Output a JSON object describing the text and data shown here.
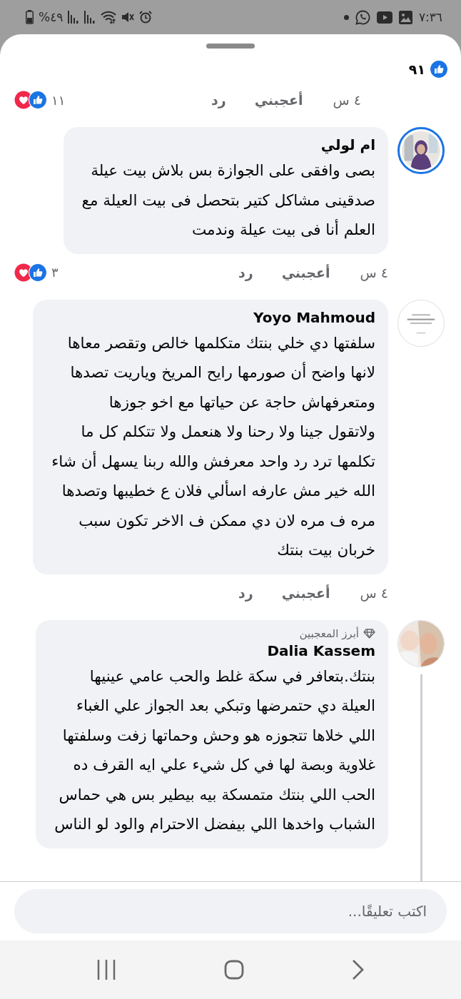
{
  "status_bar": {
    "time": "٧:٣٦",
    "battery": "%٤٩"
  },
  "reaction_summary": {
    "count": "٩١"
  },
  "previous_actions": {
    "time": "٤ س",
    "like": "أعجبني",
    "reply": "رد",
    "reaction_count": "١١"
  },
  "comments": [
    {
      "author": "ام لولي",
      "avatar_ring": true,
      "thread_line": false,
      "lines": [
        "بصى وافقى على الجوازة بس بلاش بيت عيلة",
        "صدقينى مشاكل كتير بتحصل فى بيت العيلة مع",
        "العلم أنا فى بيت عيلة وندمت"
      ],
      "actions": {
        "time": "٤ س",
        "like": "أعجبني",
        "reply": "رد",
        "reaction_count": "٣"
      }
    },
    {
      "author": "Yoyo Mahmoud",
      "avatar_ring": false,
      "thread_line": false,
      "lines": [
        "سلفتها دي خلي بنتك متكلمها خالص وتقصر معاها",
        "لانها واضح أن صورمها رايح المريخ وياريت تصدها",
        "ومتعرفهاش حاجة عن حياتها مع اخو جوزها",
        "ولاتقول جينا ولا رحنا ولا هنعمل ولا تتكلم كل ما",
        "تكلمها ترد رد واحد معرفش والله ربنا يسهل أن شاء",
        "الله خير مش عارفه اسألي فلان ع خطيبها وتصدها",
        "مره ف مره لان دي ممكن ف الاخر تكون سبب",
        "خربان بيت بنتك"
      ],
      "actions": {
        "time": "٤ س",
        "like": "أعجبني",
        "reply": "رد"
      }
    },
    {
      "author": "Dalia Kassem",
      "badge": "أبرز المعجبين",
      "avatar_ring": false,
      "thread_line": true,
      "lines": [
        "بنتك.بتعافر في سكة غلط والحب عامي عينيها",
        "العيلة دي حتمرضها وتبكي بعد الجواز علي الغباء",
        "اللي خلاها تتجوزه هو وحش وحماتها زفت وسلفتها",
        "غلاوية وبصة لها في كل شيء علي ايه القرف ده",
        "الحب اللي بنتك متمسكة بيه بيطير بس هي حماس",
        "الشباب واخدها اللي بيفضل الاحترام والود لو الناس"
      ]
    }
  ],
  "composer": {
    "placeholder": "اكتب تعليقًا..."
  }
}
